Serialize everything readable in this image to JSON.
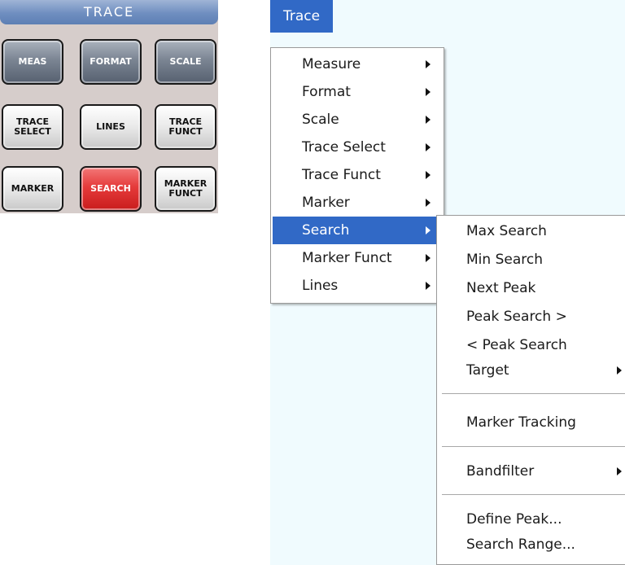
{
  "panel": {
    "title": "TRACE",
    "buttons": [
      {
        "label": "MEAS",
        "style": "dark"
      },
      {
        "label": "FORMAT",
        "style": "dark"
      },
      {
        "label": "SCALE",
        "style": "dark"
      },
      {
        "label": "TRACE\nSELECT",
        "style": "light"
      },
      {
        "label": "LINES",
        "style": "light"
      },
      {
        "label": "TRACE\nFUNCT",
        "style": "light"
      },
      {
        "label": "MARKER",
        "style": "light"
      },
      {
        "label": "SEARCH",
        "style": "red"
      },
      {
        "label": "MARKER\nFUNCT",
        "style": "light"
      }
    ]
  },
  "menubar": {
    "title": "Trace"
  },
  "main_menu": {
    "items": [
      {
        "label": "Measure",
        "has_submenu": true,
        "active": false
      },
      {
        "label": "Format",
        "has_submenu": true,
        "active": false
      },
      {
        "label": "Scale",
        "has_submenu": true,
        "active": false
      },
      {
        "label": "Trace Select",
        "has_submenu": true,
        "active": false
      },
      {
        "label": "Trace Funct",
        "has_submenu": true,
        "active": false
      },
      {
        "label": "Marker",
        "has_submenu": true,
        "active": false
      },
      {
        "label": "Search",
        "has_submenu": true,
        "active": true
      },
      {
        "label": "Marker Funct",
        "has_submenu": true,
        "active": false
      },
      {
        "label": "Lines",
        "has_submenu": true,
        "active": false
      }
    ]
  },
  "search_submenu": {
    "items": [
      {
        "label": "Max Search",
        "has_submenu": false
      },
      {
        "label": "Min Search",
        "has_submenu": false
      },
      {
        "label": "Next Peak",
        "has_submenu": false
      },
      {
        "label": "Peak Search >",
        "has_submenu": false
      },
      {
        "label": "< Peak Search",
        "has_submenu": false
      },
      {
        "label": "Target",
        "has_submenu": true
      },
      {
        "label": "Marker Tracking",
        "has_submenu": false
      },
      {
        "label": "Bandfilter",
        "has_submenu": true
      },
      {
        "label": "Define Peak...",
        "has_submenu": false
      },
      {
        "label": "Search Range...",
        "has_submenu": false
      }
    ]
  },
  "colors": {
    "menu_highlight": "#3169c6",
    "search_key_red": "#e53b3b",
    "workspace_background": "#f0fbfe"
  }
}
